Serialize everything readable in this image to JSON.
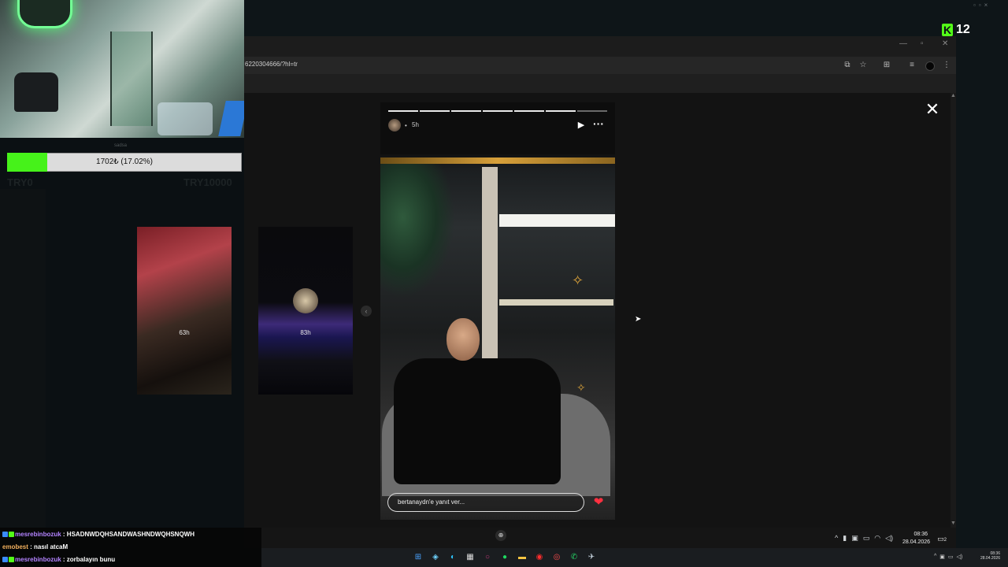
{
  "stream": {
    "goal": {
      "label": "sadsa",
      "progress_text": "1702₺ (17.02%)",
      "progress_fraction": 0.1702,
      "min_label": "TRY0",
      "max_label": "TRY10000"
    },
    "kick": {
      "logo_letter": "K",
      "viewer_count": "12"
    },
    "chat": [
      {
        "user": "mesrebinbozuk",
        "message": " : HSADNWDQHSANDWASHNDWQHSNQWH"
      },
      {
        "user": "emobest",
        "message": " : nasıl atcaM"
      },
      {
        "user": "mesrebinbozuk",
        "message": " : zorbalayın bunu"
      }
    ]
  },
  "browser": {
    "url": "6220304666/?hl=tr"
  },
  "story": {
    "time_ago": "5h",
    "reply_placeholder": "bertanaydn'e yanıt ver...",
    "segments_total": 7,
    "segments_viewed": 6,
    "thumbnails": [
      {
        "time_ago": "63h"
      },
      {
        "time_ago": "83h"
      }
    ]
  },
  "taskbar": {
    "time": "08:36",
    "date": "28.04.2026",
    "notification_count": "2",
    "mini_time": "08:36",
    "mini_date": "28.04.2026"
  },
  "colors": {
    "goal_fill": "#46f21a",
    "kick_green": "#53fc18",
    "heart": "#ff3040",
    "chat_user": "#b383ff"
  },
  "icons": [
    "close-icon",
    "play-icon",
    "more-icon",
    "heart-icon",
    "zoom-icon",
    "star-icon",
    "extensions-icon"
  ]
}
